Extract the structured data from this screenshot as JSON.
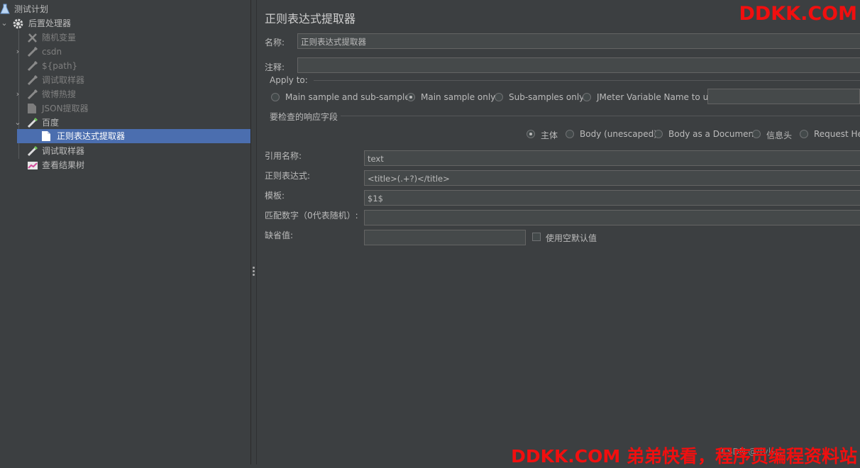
{
  "tree": {
    "items": [
      {
        "label": "测试计划",
        "icon": "flask-icon",
        "disabled": false,
        "expanded": true
      },
      {
        "label": "后置处理器",
        "icon": "gear-icon",
        "disabled": false,
        "expanded": true
      },
      {
        "label": "随机变量",
        "icon": "wrench-icon",
        "disabled": true
      },
      {
        "label": "csdn",
        "icon": "pipette-icon",
        "disabled": true,
        "collapsed": true
      },
      {
        "label": "${path}",
        "icon": "pipette-icon",
        "disabled": true
      },
      {
        "label": "调试取样器",
        "icon": "pipette-icon",
        "disabled": true
      },
      {
        "label": "微博热搜",
        "icon": "pipette-icon",
        "disabled": true,
        "collapsed": true
      },
      {
        "label": "JSON提取器",
        "icon": "document-icon",
        "disabled": true
      },
      {
        "label": "百度",
        "icon": "pipette-icon",
        "disabled": false,
        "expanded": true
      },
      {
        "label": "正则表达式提取器",
        "icon": "document-icon",
        "disabled": false,
        "selected": true
      },
      {
        "label": "调试取样器",
        "icon": "pipette-icon",
        "disabled": false
      },
      {
        "label": "查看结果树",
        "icon": "chart-icon",
        "disabled": false
      }
    ]
  },
  "panel": {
    "title": "正则表达式提取器",
    "name_label": "名称:",
    "name_value": "正则表达式提取器",
    "comment_label": "注释:",
    "comment_value": "",
    "apply_to": {
      "legend": "Apply to:",
      "options": [
        "Main sample and sub-samples",
        "Main sample only",
        "Sub-samples only",
        "JMeter Variable Name to use"
      ],
      "selected": "Main sample only",
      "variable_value": ""
    },
    "field_check": {
      "legend": "要检查的响应字段",
      "options": [
        "主体",
        "Body (unescaped)",
        "Body as a Document",
        "信息头",
        "Request Hea"
      ],
      "selected": "主体"
    },
    "ref_name_label": "引用名称:",
    "ref_name_value": "text",
    "regex_label": "正则表达式:",
    "regex_value": "<title>(.+?)</title>",
    "template_label": "模板:",
    "template_value": "$1$",
    "match_no_label": "匹配数字（0代表随机）:",
    "match_no_value": "",
    "default_label": "缺省值:",
    "default_value": "",
    "use_empty_label": "使用空默认值",
    "use_empty_checked": false
  },
  "watermark": {
    "top": "DDKK.COM",
    "bottom": "DDKK.COM 弟弟快看，程序员编程资料站",
    "faint": "CSDN @小小..."
  },
  "colors": {
    "background": "#3c3f41",
    "selection": "#4b6eaf",
    "watermark": "#f10f0f"
  }
}
